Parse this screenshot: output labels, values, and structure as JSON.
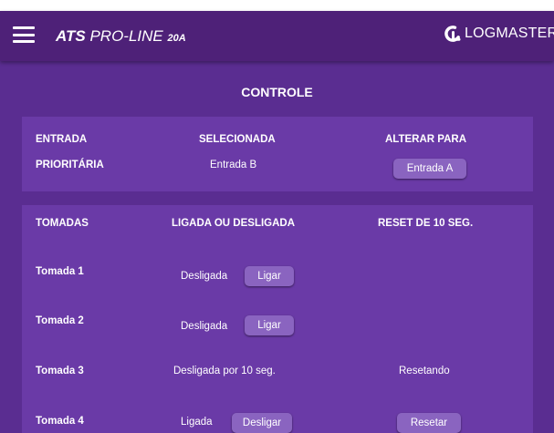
{
  "header": {
    "brand_bold": "ATS",
    "brand_light": " PRO-LINE ",
    "brand_model": "20A",
    "logo_text": "LOGMASTER"
  },
  "page": {
    "title": "CONTROLE"
  },
  "priority": {
    "col1": "ENTRADA",
    "col2": "SELECIONADA",
    "col3": "ALTERAR PARA",
    "row_label": "PRIORITÁRIA",
    "selected": "Entrada B",
    "switch_button": "Entrada A"
  },
  "outlets": {
    "headers": {
      "name": "TOMADAS",
      "state": "LIGADA OU DESLIGADA",
      "reset": "RESET DE 10 SEG."
    },
    "rows": [
      {
        "name": "Tomada 1",
        "state": "Desligada",
        "action": "Ligar",
        "reset": ""
      },
      {
        "name": "Tomada 2",
        "state": "Desligada",
        "action": "Ligar",
        "reset": ""
      },
      {
        "name": "Tomada 3",
        "state": "Desligada por 10 seg.",
        "action": "",
        "reset": "Resetando"
      },
      {
        "name": "Tomada 4",
        "state": "Ligada",
        "action": "Desligar",
        "reset": "Resetar"
      }
    ]
  },
  "colors": {
    "background": "#5a2d91",
    "header": "#4e2178",
    "card": "#6a3aa7",
    "button": "#8a64c0"
  }
}
